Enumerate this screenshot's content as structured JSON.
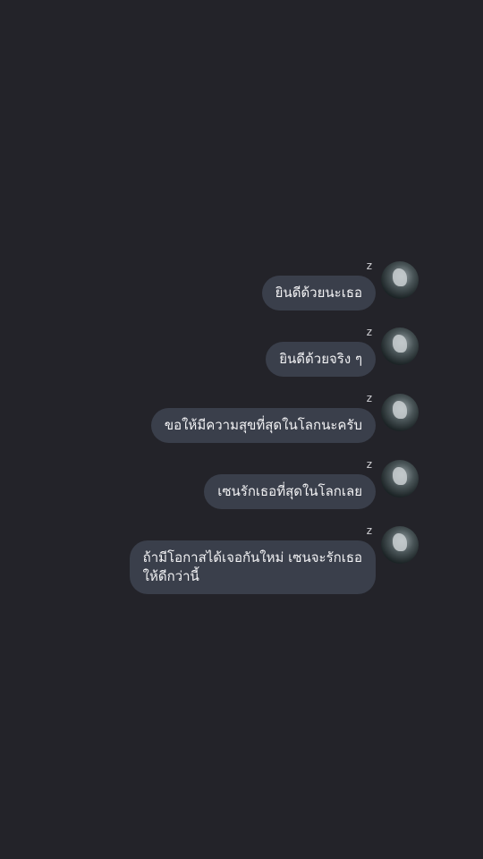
{
  "chat": {
    "messages": [
      {
        "sender": "z",
        "text": "ยินดีด้วยนะเธอ"
      },
      {
        "sender": "z",
        "text": "ยินดีด้วยจริง ๆ"
      },
      {
        "sender": "z",
        "text": "ขอให้มีความสุขที่สุดในโลกนะครับ"
      },
      {
        "sender": "z",
        "text": "เซนรักเธอที่สุดในโลกเลย"
      },
      {
        "sender": "z",
        "text": "ถ้ามีโอกาสได้เจอกันใหม่ เซนจะรักเธอ\nให้ดีกว่านี้"
      }
    ]
  },
  "colors": {
    "background": "#232329",
    "bubble": "#3a3f4b",
    "text": "#f2f2f4"
  }
}
